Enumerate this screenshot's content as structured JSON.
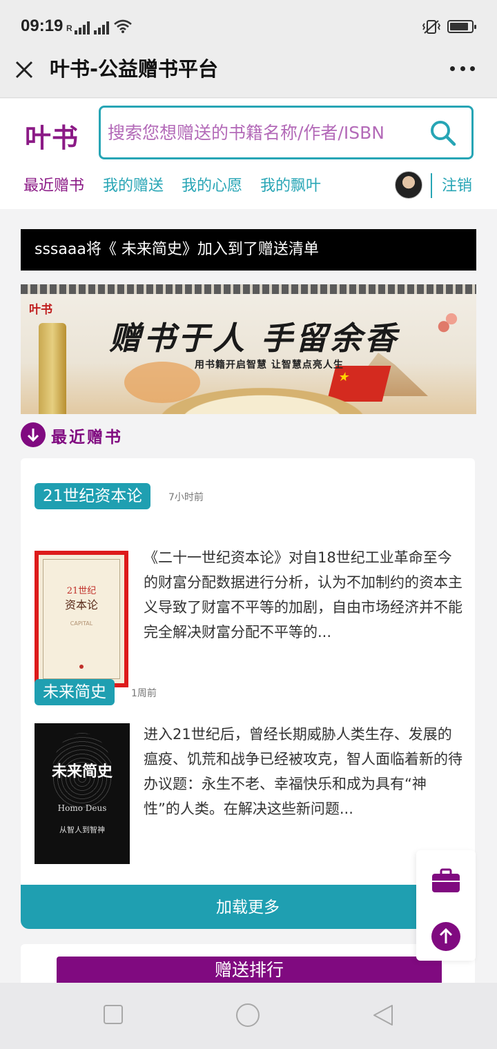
{
  "status_bar": {
    "time": "09:19",
    "network_label": "R"
  },
  "app_bar": {
    "title": "叶书-公益赠书平台"
  },
  "site_header": {
    "logo": "叶书",
    "search_placeholder": "搜索您想赠送的书籍名称/作者/ISBN",
    "nav": [
      {
        "label": "最近赠书",
        "active": true
      },
      {
        "label": "我的赠送",
        "active": false
      },
      {
        "label": "我的心愿",
        "active": false
      },
      {
        "label": "我的飘叶",
        "active": false
      }
    ],
    "logout_label": "注销"
  },
  "notice": "sssaaa将《 未来简史》加入到了赠送清单",
  "banner": {
    "brand": "叶书",
    "headline": "赠书于人 手留余香",
    "subtitle": "用书籍开启智慧 让智慧点亮人生"
  },
  "section": {
    "title": "最近赠书"
  },
  "books": [
    {
      "title": "21世纪资本论",
      "time_ago": "7小时前",
      "cover_text_1": "21世纪",
      "cover_text_2": "资本论",
      "cover_text_3": "CAPITAL",
      "description": "《二十一世纪资本论》对自18世纪工业革命至今的财富分配数据进行分析，认为不加制约的资本主义导致了财富不平等的加剧，自由市场经济并不能完全解决财富分配不平等的..."
    },
    {
      "title": "未来简史",
      "time_ago": "1周前",
      "cover_text_1": "未来简史",
      "cover_text_2": "Homo Deus",
      "cover_text_3": "从智人到智神",
      "description": "进入21世纪后，曾经长期威胁人类生存、发展的瘟疫、饥荒和战争已经被攻克，智人面临着新的待办议题：永生不老、幸福快乐和成为具有“神性”的人类。在解决这些新问题..."
    }
  ],
  "load_more_label": "加载更多",
  "ranking_label": "赠送排行",
  "colors": {
    "brand_purple": "#800a80",
    "accent_teal": "#1f9fb1",
    "notice_bg": "#000000"
  }
}
